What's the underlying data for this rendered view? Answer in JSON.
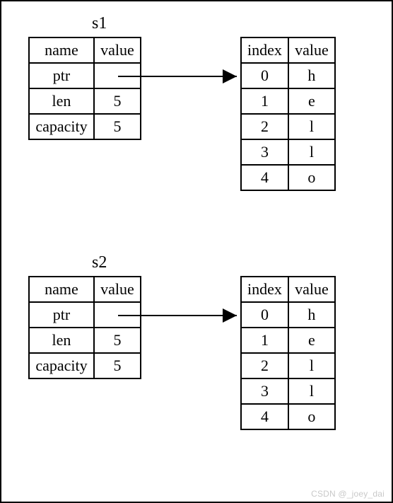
{
  "s1": {
    "label": "s1",
    "meta": {
      "headers": {
        "name": "name",
        "value": "value"
      },
      "rows": [
        {
          "name": "ptr",
          "value": ""
        },
        {
          "name": "len",
          "value": "5"
        },
        {
          "name": "capacity",
          "value": "5"
        }
      ]
    },
    "heap": {
      "headers": {
        "index": "index",
        "value": "value"
      },
      "rows": [
        {
          "index": "0",
          "value": "h"
        },
        {
          "index": "1",
          "value": "e"
        },
        {
          "index": "2",
          "value": "l"
        },
        {
          "index": "3",
          "value": "l"
        },
        {
          "index": "4",
          "value": "o"
        }
      ]
    }
  },
  "s2": {
    "label": "s2",
    "meta": {
      "headers": {
        "name": "name",
        "value": "value"
      },
      "rows": [
        {
          "name": "ptr",
          "value": ""
        },
        {
          "name": "len",
          "value": "5"
        },
        {
          "name": "capacity",
          "value": "5"
        }
      ]
    },
    "heap": {
      "headers": {
        "index": "index",
        "value": "value"
      },
      "rows": [
        {
          "index": "0",
          "value": "h"
        },
        {
          "index": "1",
          "value": "e"
        },
        {
          "index": "2",
          "value": "l"
        },
        {
          "index": "3",
          "value": "l"
        },
        {
          "index": "4",
          "value": "o"
        }
      ]
    }
  },
  "watermark": "CSDN @_joey_dai"
}
